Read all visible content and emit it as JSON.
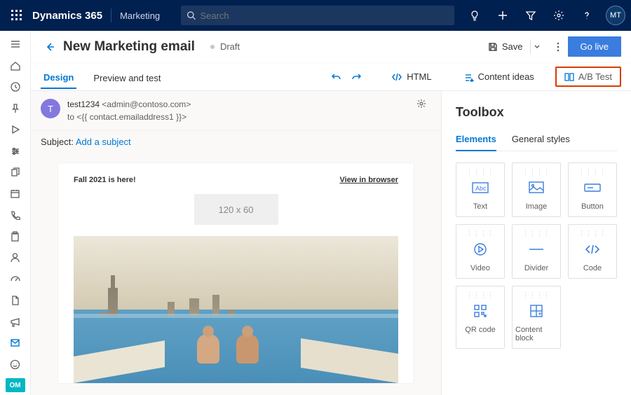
{
  "header": {
    "brand": "Dynamics 365",
    "app": "Marketing",
    "search_placeholder": "Search",
    "avatar_initials": "MT"
  },
  "page": {
    "title": "New Marketing email",
    "status": "Draft",
    "save_label": "Save",
    "golive_label": "Go live"
  },
  "toolbar": {
    "tabs": {
      "design": "Design",
      "preview": "Preview and test"
    },
    "html": "HTML",
    "ideas": "Content ideas",
    "abtest": "A/B Test"
  },
  "email": {
    "avatar_letter": "T",
    "from_name": "test1234",
    "from_addr": "<admin@contoso.com>",
    "to_prefix": "to ",
    "to_value": "<{{ contact.emailaddress1 }}>",
    "subject_label": "Subject:",
    "subject_placeholder": "Add a subject"
  },
  "canvas": {
    "headline": "Fall 2021 is here!",
    "view_in_browser": "View in browser",
    "logo_placeholder": "120 x 60"
  },
  "toolbox": {
    "title": "Toolbox",
    "tabs": {
      "elements": "Elements",
      "styles": "General styles"
    },
    "items": [
      {
        "label": "Text"
      },
      {
        "label": "Image"
      },
      {
        "label": "Button"
      },
      {
        "label": "Video"
      },
      {
        "label": "Divider"
      },
      {
        "label": "Code"
      },
      {
        "label": "QR code"
      },
      {
        "label": "Content block"
      }
    ]
  },
  "rail_badge": "OM"
}
